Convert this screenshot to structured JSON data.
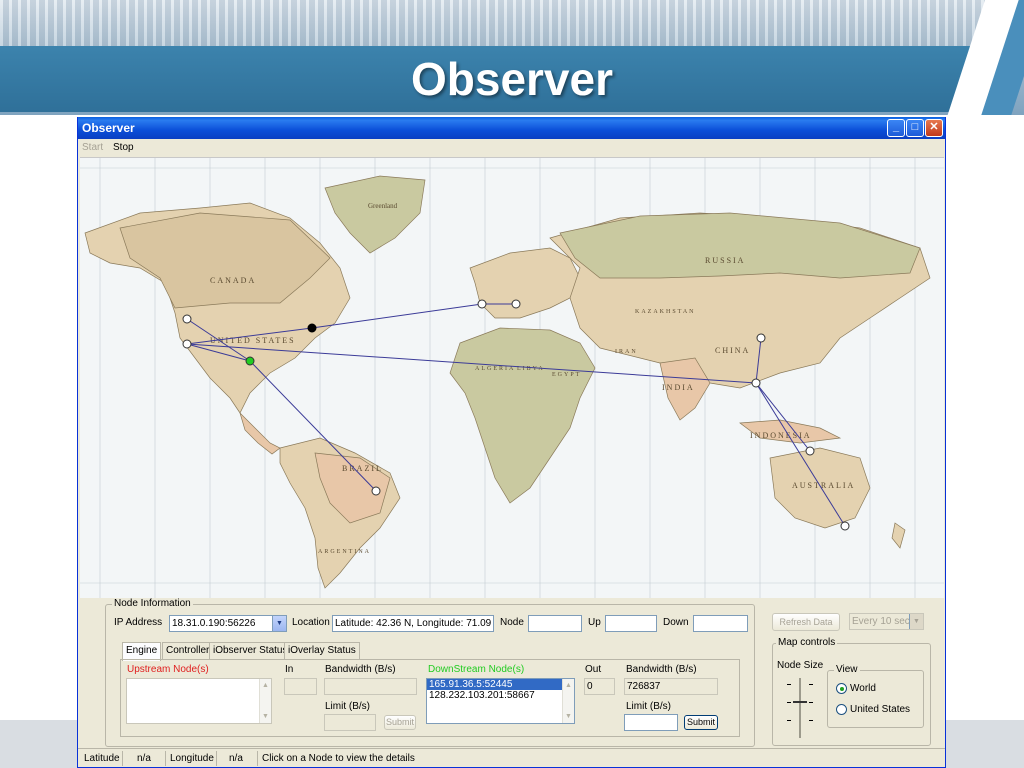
{
  "slide": {
    "title": "Observer"
  },
  "window": {
    "title": "Observer",
    "menu": {
      "start": "Start",
      "stop": "Stop"
    }
  },
  "node_info": {
    "group_label": "Node Information",
    "ip_label": "IP Address",
    "ip_value": "18.31.0.190:56226",
    "location_label": "Location",
    "location_value": "Latitude: 42.36 N, Longitude: 71.09 W",
    "node_label": "Node",
    "node_value": "",
    "up_label": "Up",
    "up_value": "",
    "down_label": "Down",
    "down_value": ""
  },
  "tabs": [
    "Engine",
    "Controller",
    "iObserver Status",
    "iOverlay Status"
  ],
  "engine": {
    "upstream_label": "Upstream Node(s)",
    "in_label": "In",
    "in_value": "",
    "bandwidth_label_left": "Bandwidth (B/s)",
    "bandwidth_value_left": "",
    "limit_label_left": "Limit (B/s)",
    "limit_value_left": "",
    "submit_left": "Submit",
    "downstream_label": "DownStream Node(s)",
    "downstream_nodes": [
      "165.91.36.5:52445",
      "128.232.103.201:58667"
    ],
    "out_label": "Out",
    "out_value": "0",
    "bandwidth_label_right": "Bandwidth (B/s)",
    "bandwidth_value_right": "726837",
    "limit_label_right": "Limit (B/s)",
    "limit_value_right": "",
    "submit_right": "Submit"
  },
  "refresh": {
    "button": "Refresh Data",
    "interval": "Every 10 sec."
  },
  "map_controls": {
    "group_label": "Map controls",
    "node_size_label": "Node Size",
    "view_label": "View",
    "view_options": [
      "World",
      "United States"
    ],
    "view_selected": "World"
  },
  "status": {
    "latitude_label": "Latitude",
    "latitude_value": "n/a",
    "longitude_label": "Longitude",
    "longitude_value": "n/a",
    "message": "Click on a Node to view the details"
  },
  "map": {
    "country_labels": [
      "CANADA",
      "UNITED STATES",
      "RUSSIA",
      "CHINA",
      "INDIA",
      "BRAZIL",
      "AUSTRALIA",
      "INDONESIA",
      "ARGENTINA",
      "ALGERIA",
      "LIBYA",
      "EGYPT",
      "IRAN",
      "KAZAKHSTAN",
      "Greenland"
    ],
    "colors": {
      "ocean": "#f3f6f7",
      "land_tan": "#e4d2b0",
      "land_green": "#c9c9a0",
      "land_pink": "#e8c7a8",
      "link": "#3b3b98",
      "node_selected": "#22cc22",
      "node_source": "#000000"
    }
  }
}
